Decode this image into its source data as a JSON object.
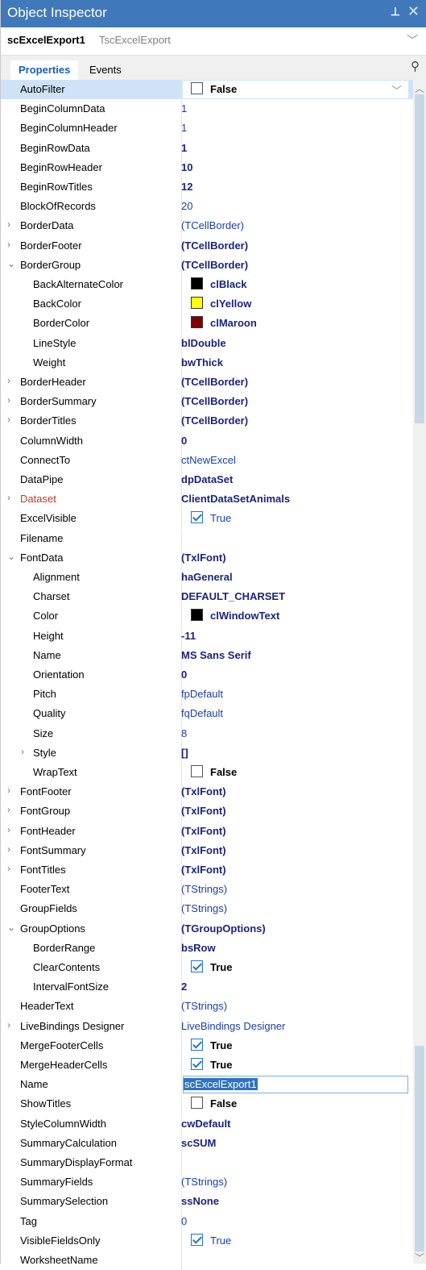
{
  "title": "Object Inspector",
  "title_pin": "⊥",
  "title_close": "✕",
  "component": {
    "name": "scExcelExport1",
    "class": "TscExcelExport"
  },
  "tabs": {
    "properties": "Properties",
    "events": "Events"
  },
  "colors": {
    "accent": "#3f79ba",
    "selected_row": "#cfe3f8",
    "value_blue": "#1a3ea8"
  },
  "properties": [
    {
      "name": "AutoFilter",
      "indent": 0,
      "value": "False",
      "style": "bold",
      "box": "checkbox",
      "checked": false,
      "selected": true,
      "editor": "combo"
    },
    {
      "name": "BeginColumnData",
      "indent": 0,
      "value": "1",
      "style": "normal"
    },
    {
      "name": "BeginColumnHeader",
      "indent": 0,
      "value": "1",
      "style": "normal"
    },
    {
      "name": "BeginRowData",
      "indent": 0,
      "value": "1",
      "style": "bold"
    },
    {
      "name": "BeginRowHeader",
      "indent": 0,
      "value": "10",
      "style": "bold"
    },
    {
      "name": "BeginRowTitles",
      "indent": 0,
      "value": "12",
      "style": "bold"
    },
    {
      "name": "BlockOfRecords",
      "indent": 0,
      "value": "20",
      "style": "normal"
    },
    {
      "name": "BorderData",
      "indent": 0,
      "expander": "›",
      "value": "(TCellBorder)",
      "style": "normal"
    },
    {
      "name": "BorderFooter",
      "indent": 0,
      "expander": "›",
      "value": "(TCellBorder)",
      "style": "bold"
    },
    {
      "name": "BorderGroup",
      "indent": 0,
      "expander": "⌄",
      "value": "(TCellBorder)",
      "style": "bold"
    },
    {
      "name": "BackAlternateColor",
      "indent": 1,
      "value": "clBlack",
      "style": "bold",
      "box": "swatch",
      "swatch": "#000000"
    },
    {
      "name": "BackColor",
      "indent": 1,
      "value": "clYellow",
      "style": "bold",
      "box": "swatch",
      "swatch": "#ffff00"
    },
    {
      "name": "BorderColor",
      "indent": 1,
      "value": "clMaroon",
      "style": "bold",
      "box": "swatch",
      "swatch": "#800000"
    },
    {
      "name": "LineStyle",
      "indent": 1,
      "value": "blDouble",
      "style": "bold"
    },
    {
      "name": "Weight",
      "indent": 1,
      "value": "bwThick",
      "style": "bold"
    },
    {
      "name": "BorderHeader",
      "indent": 0,
      "expander": "›",
      "value": "(TCellBorder)",
      "style": "bold"
    },
    {
      "name": "BorderSummary",
      "indent": 0,
      "expander": "›",
      "value": "(TCellBorder)",
      "style": "bold"
    },
    {
      "name": "BorderTitles",
      "indent": 0,
      "expander": "›",
      "value": "(TCellBorder)",
      "style": "bold"
    },
    {
      "name": "ColumnWidth",
      "indent": 0,
      "value": "0",
      "style": "bold"
    },
    {
      "name": "ConnectTo",
      "indent": 0,
      "value": "ctNewExcel",
      "style": "normal"
    },
    {
      "name": "DataPipe",
      "indent": 0,
      "value": "dpDataSet",
      "style": "bold"
    },
    {
      "name": "Dataset",
      "indent": 0,
      "expander": "›",
      "value": "ClientDataSetAnimals",
      "style": "bold",
      "red": true
    },
    {
      "name": "ExcelVisible",
      "indent": 0,
      "value": "True",
      "style": "normal",
      "box": "checkbox",
      "checked": true
    },
    {
      "name": "Filename",
      "indent": 0,
      "value": "",
      "style": "normal"
    },
    {
      "name": "FontData",
      "indent": 0,
      "expander": "⌄",
      "value": "(TxlFont)",
      "style": "bold"
    },
    {
      "name": "Alignment",
      "indent": 1,
      "value": "haGeneral",
      "style": "bold"
    },
    {
      "name": "Charset",
      "indent": 1,
      "value": "DEFAULT_CHARSET",
      "style": "bold"
    },
    {
      "name": "Color",
      "indent": 1,
      "value": "clWindowText",
      "style": "bold",
      "box": "swatch",
      "swatch": "#000000"
    },
    {
      "name": "Height",
      "indent": 1,
      "value": "-11",
      "style": "bold"
    },
    {
      "name": "Name",
      "indent": 1,
      "value": "MS Sans Serif",
      "style": "bold"
    },
    {
      "name": "Orientation",
      "indent": 1,
      "value": "0",
      "style": "bold"
    },
    {
      "name": "Pitch",
      "indent": 1,
      "value": "fpDefault",
      "style": "normal"
    },
    {
      "name": "Quality",
      "indent": 1,
      "value": "fqDefault",
      "style": "normal"
    },
    {
      "name": "Size",
      "indent": 1,
      "value": "8",
      "style": "normal"
    },
    {
      "name": "Style",
      "indent": 1,
      "expander": "›",
      "value": "[]",
      "style": "bold"
    },
    {
      "name": "WrapText",
      "indent": 1,
      "value": "False",
      "style": "bold",
      "box": "checkbox",
      "checked": false
    },
    {
      "name": "FontFooter",
      "indent": 0,
      "expander": "›",
      "value": "(TxlFont)",
      "style": "bold"
    },
    {
      "name": "FontGroup",
      "indent": 0,
      "expander": "›",
      "value": "(TxlFont)",
      "style": "bold"
    },
    {
      "name": "FontHeader",
      "indent": 0,
      "expander": "›",
      "value": "(TxlFont)",
      "style": "bold"
    },
    {
      "name": "FontSummary",
      "indent": 0,
      "expander": "›",
      "value": "(TxlFont)",
      "style": "bold"
    },
    {
      "name": "FontTitles",
      "indent": 0,
      "expander": "›",
      "value": "(TxlFont)",
      "style": "bold"
    },
    {
      "name": "FooterText",
      "indent": 0,
      "value": "(TStrings)",
      "style": "normal"
    },
    {
      "name": "GroupFields",
      "indent": 0,
      "value": "(TStrings)",
      "style": "normal"
    },
    {
      "name": "GroupOptions",
      "indent": 0,
      "expander": "⌄",
      "value": "(TGroupOptions)",
      "style": "bold"
    },
    {
      "name": "BorderRange",
      "indent": 1,
      "value": "bsRow",
      "style": "bold"
    },
    {
      "name": "ClearContents",
      "indent": 1,
      "value": "True",
      "style": "bold",
      "box": "checkbox",
      "checked": true
    },
    {
      "name": "IntervalFontSize",
      "indent": 1,
      "value": "2",
      "style": "bold"
    },
    {
      "name": "HeaderText",
      "indent": 0,
      "value": "(TStrings)",
      "style": "normal"
    },
    {
      "name": "LiveBindings Designer",
      "indent": 0,
      "expander": "›",
      "value": "LiveBindings Designer",
      "style": "normal"
    },
    {
      "name": "MergeFooterCells",
      "indent": 0,
      "value": "True",
      "style": "bold",
      "box": "checkbox",
      "checked": true
    },
    {
      "name": "MergeHeaderCells",
      "indent": 0,
      "value": "True",
      "style": "bold",
      "box": "checkbox",
      "checked": true
    },
    {
      "name": "Name",
      "indent": 0,
      "value": "scExcelExport1",
      "style": "normal",
      "editor": "name"
    },
    {
      "name": "ShowTitles",
      "indent": 0,
      "value": "False",
      "style": "bold",
      "box": "checkbox",
      "checked": false
    },
    {
      "name": "StyleColumnWidth",
      "indent": 0,
      "value": "cwDefault",
      "style": "bold"
    },
    {
      "name": "SummaryCalculation",
      "indent": 0,
      "value": "scSUM",
      "style": "bold"
    },
    {
      "name": "SummaryDisplayFormat",
      "indent": 0,
      "value": "",
      "style": "normal"
    },
    {
      "name": "SummaryFields",
      "indent": 0,
      "value": "(TStrings)",
      "style": "normal"
    },
    {
      "name": "SummarySelection",
      "indent": 0,
      "value": "ssNone",
      "style": "bold"
    },
    {
      "name": "Tag",
      "indent": 0,
      "value": "0",
      "style": "normal"
    },
    {
      "name": "VisibleFieldsOnly",
      "indent": 0,
      "value": "True",
      "style": "normal",
      "box": "checkbox",
      "checked": true
    },
    {
      "name": "WorksheetName",
      "indent": 0,
      "value": "",
      "style": "normal"
    }
  ]
}
